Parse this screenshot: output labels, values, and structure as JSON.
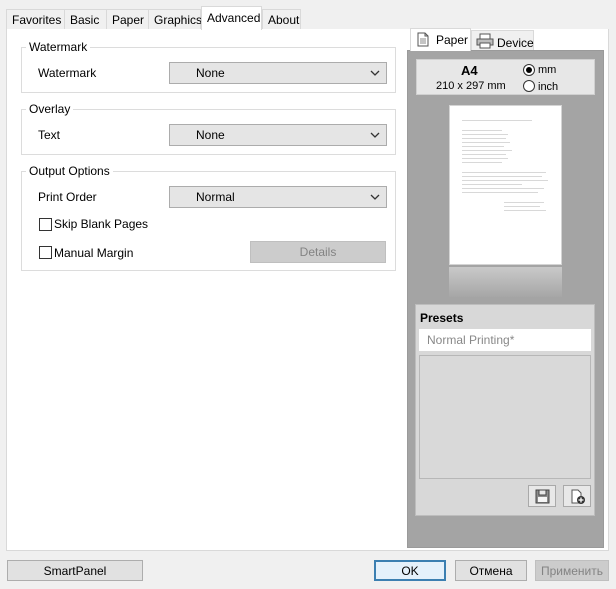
{
  "tabs": [
    "Favorites",
    "Basic",
    "Paper",
    "Graphics",
    "Advanced",
    "About"
  ],
  "active_tab": "Advanced",
  "watermark": {
    "group_title": "Watermark",
    "label": "Watermark",
    "value": "None"
  },
  "overlay": {
    "group_title": "Overlay",
    "label": "Text",
    "value": "None"
  },
  "output": {
    "group_title": "Output Options",
    "print_order_label": "Print Order",
    "print_order_value": "Normal",
    "skip_blank_label": "Skip Blank Pages",
    "skip_blank_checked": false,
    "manual_margin_label": "Manual Margin",
    "manual_margin_checked": false,
    "details_label": "Details"
  },
  "preview": {
    "tabs": [
      "Paper",
      "Device"
    ],
    "paper_icon": "paper-icon",
    "device_icon": "printer-icon",
    "size_name": "A4",
    "size_dims": "210 x 297 mm",
    "unit_mm": "mm",
    "unit_inch": "inch",
    "unit_selected": "mm"
  },
  "presets": {
    "title": "Presets",
    "current": "Normal Printing*",
    "save_icon": "save-icon",
    "new_icon": "add-document-icon"
  },
  "buttons": {
    "smartpanel": "SmartPanel",
    "ok": "OK",
    "cancel": "Отмена",
    "apply": "Применить"
  }
}
